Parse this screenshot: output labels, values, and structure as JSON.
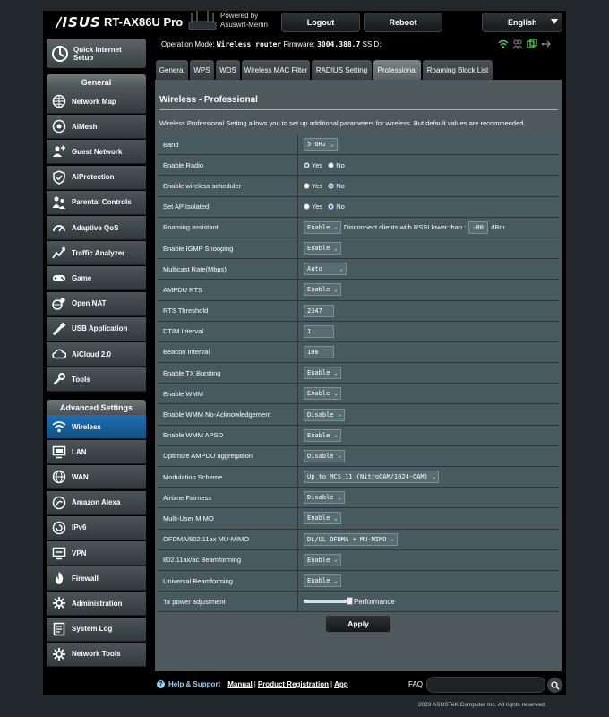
{
  "header": {
    "logo": "/ISUS",
    "model": "RT-AX86U Pro",
    "powered_by": "Powered by",
    "powered_name": "Asuswrt-Merlin",
    "logout": "Logout",
    "reboot": "Reboot",
    "language": "English"
  },
  "topinfo": {
    "opmode_label": "Operation Mode:",
    "opmode_value": "Wireless router",
    "firmware_label": "Firmware:",
    "firmware_value": "3004.388.7",
    "ssid_label": "SSID:"
  },
  "sidebar": {
    "quick_setup": "Quick Internet Setup",
    "general_header": "General",
    "general_items": [
      "Network Map",
      "AiMesh",
      "Guest Network",
      "AiProtection",
      "Parental Controls",
      "Adaptive QoS",
      "Traffic Analyzer",
      "Game",
      "Open NAT",
      "USB Application",
      "AiCloud 2.0",
      "Tools"
    ],
    "advanced_header": "Advanced Settings",
    "advanced_items": [
      "Wireless",
      "LAN",
      "WAN",
      "Amazon Alexa",
      "IPv6",
      "VPN",
      "Firewall",
      "Administration",
      "System Log",
      "Network Tools"
    ]
  },
  "tabs": [
    "General",
    "WPS",
    "WDS",
    "Wireless MAC Filter",
    "RADIUS Setting",
    "Professional",
    "Roaming Block List"
  ],
  "content": {
    "title": "Wireless - Professional",
    "description": "Wireless Professional Setting allows you to set up additional parameters for wireless. But default values are recommended.",
    "yes": "Yes",
    "no": "No",
    "rows": [
      {
        "label": "Band",
        "value": "5 GHz"
      },
      {
        "label": "Enable Radio",
        "value": ""
      },
      {
        "label": "Enable wireless scheduler",
        "value": ""
      },
      {
        "label": "Set AP Isolated",
        "value": ""
      },
      {
        "label": "Roaming assistant",
        "value": "Enable",
        "extra": "Disconnect clients with RSSI lower than :",
        "rssi": "-80",
        "unit": "dBm"
      },
      {
        "label": "Enable IGMP Snooping",
        "value": "Enable"
      },
      {
        "label": "Multicast Rate(Mbps)",
        "value": "Auto"
      },
      {
        "label": "AMPDU RTS",
        "value": "Enable"
      },
      {
        "label": "RTS Threshold",
        "value": "2347"
      },
      {
        "label": "DTIM Interval",
        "value": "1"
      },
      {
        "label": "Beacon Interval",
        "value": "100"
      },
      {
        "label": "Enable TX Bursting",
        "value": "Enable"
      },
      {
        "label": "Enable WMM",
        "value": "Enable"
      },
      {
        "label": "Enable WMM No-Acknowledgement",
        "value": "Disable"
      },
      {
        "label": "Enable WMM APSD",
        "value": "Enable"
      },
      {
        "label": "Optimize AMPDU aggregation",
        "value": "Disable"
      },
      {
        "label": "Modulation Scheme",
        "value": "Up to MCS 11 (NitroQAM/1024-QAM)"
      },
      {
        "label": "Airtime Fairness",
        "value": "Disable"
      },
      {
        "label": "Multi-User MIMO",
        "value": "Enable"
      },
      {
        "label": "OFDMA/802.11ax MU-MIMO",
        "value": "DL/UL OFDMA + MU-MIMO"
      },
      {
        "label": "802.11ax/ac Beamforming",
        "value": "Enable"
      },
      {
        "label": "Universal Beamforming",
        "value": "Enable"
      },
      {
        "label": "Tx power adjustment",
        "value": "Performance",
        "level": 1.0
      }
    ],
    "apply": "Apply"
  },
  "footer": {
    "help": "Help & Support",
    "manual": "Manual",
    "registration": "Product Registration",
    "app": "App",
    "sep": "|",
    "faq": "FAQ",
    "copyright": "2023 ASUSTeK Computer Inc. All rights reserved."
  }
}
